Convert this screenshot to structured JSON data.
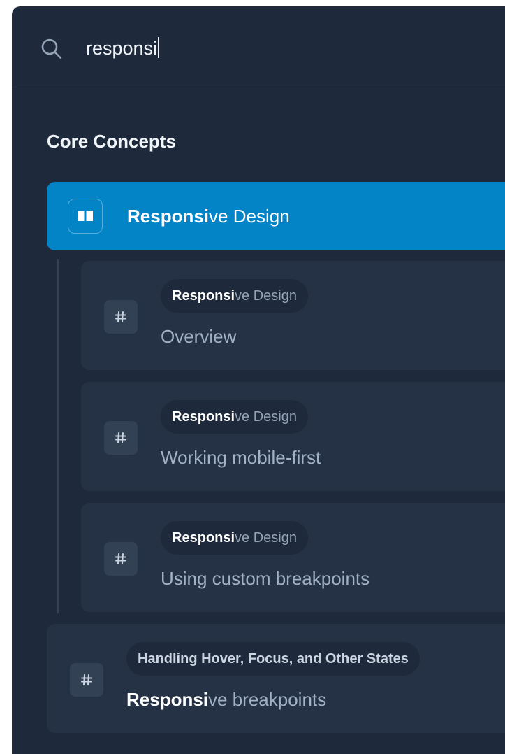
{
  "search": {
    "query": "responsi"
  },
  "section": {
    "title": "Core Concepts"
  },
  "primary_hit": {
    "match": "Responsi",
    "rest": "ve Design",
    "icon": "book-icon"
  },
  "sub_hits": [
    {
      "breadcrumb_match": "Responsi",
      "breadcrumb_rest": "ve Design",
      "title": "Overview",
      "icon": "hash-icon"
    },
    {
      "breadcrumb_match": "Responsi",
      "breadcrumb_rest": "ve Design",
      "title": "Working mobile-first",
      "icon": "hash-icon"
    },
    {
      "breadcrumb_match": "Responsi",
      "breadcrumb_rest": "ve Design",
      "title": "Using custom breakpoints",
      "icon": "hash-icon"
    }
  ],
  "other_hit": {
    "breadcrumb": "Handling Hover, Focus, and Other States",
    "title_match": "Responsi",
    "title_rest": "ve breakpoints",
    "icon": "hash-icon"
  },
  "colors": {
    "panel_bg": "#1e293b",
    "accent": "#0284c7",
    "card_bg": "#253245"
  }
}
